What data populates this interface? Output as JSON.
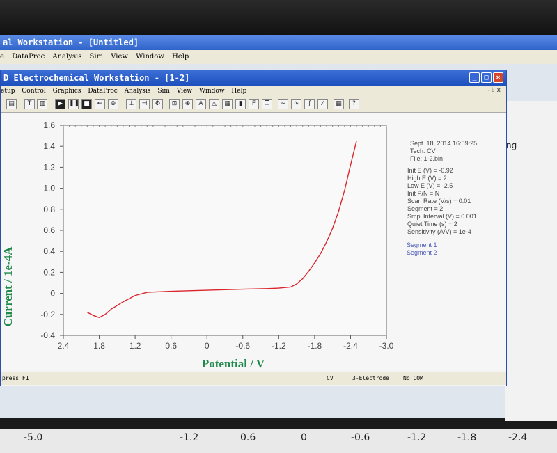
{
  "outer": {
    "title": "al Workstation - [Untitled]",
    "menu": [
      "e",
      "DataProc",
      "Analysis",
      "Sim",
      "View",
      "Window",
      "Help"
    ],
    "right_fragment": "ng",
    "bottom_ticks": [
      "-5.0",
      "-1.2",
      "0.6",
      "0",
      "-0.6",
      "-1.2",
      "-1.8",
      "-2.4"
    ]
  },
  "inner": {
    "title": "D Electrochemical Workstation - [1-2]",
    "menu": [
      "etup",
      "Control",
      "Graphics",
      "DataProc",
      "Analysis",
      "Sim",
      "View",
      "Window",
      "Help"
    ],
    "mdi_controls": "- ♭ x",
    "status": {
      "left": "press F1",
      "tech": "CV",
      "electrode": "3-Electrode",
      "com": "No COM"
    }
  },
  "params": {
    "datetime": "Sept. 18, 2014   16:59:25",
    "tech": "Tech: CV",
    "file": "File: 1-2.bin",
    "lines": [
      "Init E (V) = -0.92",
      "High E (V) = 2",
      "Low E (V) = -2.5",
      "Init P/N = N",
      "Scan Rate (V/s) = 0.01",
      "Segment = 2",
      "Smpl Interval (V) = 0.001",
      "Quiet Time (s) = 2",
      "Sensitivity (A/V) = 1e-4"
    ],
    "segments": [
      "Segment 1",
      "Segment 2"
    ]
  },
  "colors": {
    "curve": "#d9262c",
    "axis_title": "#1f8a4a",
    "titlebar": "#1d4fbd"
  },
  "chart_data": {
    "type": "line",
    "xlabel": "Potential / V",
    "ylabel": "Current / 1e-4A",
    "x_ticks": [
      "2.4",
      "1.8",
      "1.2",
      "0.6",
      "0",
      "-0.6",
      "-1.2",
      "-1.8",
      "-2.4",
      "-3.0"
    ],
    "y_ticks": [
      "1.6",
      "1.4",
      "1.2",
      "1.0",
      "0.8",
      "0.6",
      "0.4",
      "0.2",
      "0",
      "-0.2",
      "-0.4"
    ],
    "xlim": [
      2.4,
      -3.0
    ],
    "ylim": [
      -0.4,
      1.6
    ],
    "grid": false,
    "series": [
      {
        "x": [
          2.0,
          1.9,
          1.8,
          1.7,
          1.6,
          1.4,
          1.2,
          1.0,
          0.6,
          0.0,
          -0.6,
          -1.0,
          -1.2,
          -1.4,
          -1.5,
          -1.6,
          -1.7,
          -1.8,
          -1.9,
          -2.0,
          -2.1,
          -2.2,
          -2.3,
          -2.4,
          -2.5
        ],
        "y": [
          -0.18,
          -0.21,
          -0.23,
          -0.2,
          -0.15,
          -0.08,
          -0.02,
          0.01,
          0.02,
          0.03,
          0.04,
          0.045,
          0.05,
          0.06,
          0.09,
          0.14,
          0.21,
          0.29,
          0.38,
          0.49,
          0.62,
          0.78,
          0.98,
          1.22,
          1.45
        ]
      }
    ]
  }
}
